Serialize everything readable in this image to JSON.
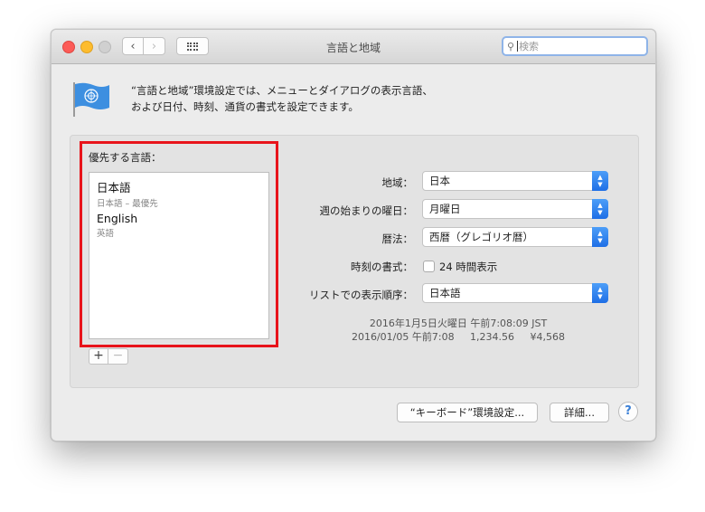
{
  "window": {
    "title": "言語と地域",
    "search_placeholder": "検索"
  },
  "description": {
    "line1": "“言語と地域”環境設定では、メニューとダイアログの表示言語、",
    "line2": "および日付、時刻、通貨の書式を設定できます。"
  },
  "languages": {
    "title": "優先する言語：",
    "items": [
      {
        "name": "日本語",
        "sub": "日本語 – 最優先"
      },
      {
        "name": "English",
        "sub": "英語"
      }
    ],
    "add_label": "+",
    "remove_label": "−"
  },
  "settings": {
    "region_label": "地域：",
    "region_value": "日本",
    "week_label": "週の始まりの曜日：",
    "week_value": "月曜日",
    "calendar_label": "暦法：",
    "calendar_value": "西暦（グレゴリオ暦）",
    "time_label": "時刻の書式：",
    "time_checkbox_label": "24 時間表示",
    "sort_label": "リストでの表示順序：",
    "sort_value": "日本語"
  },
  "sample": {
    "line1": "2016年1月5日火曜日 午前7:08:09 JST",
    "line2": "2016/01/05 午前7:08     1,234.56     ¥4,568"
  },
  "buttons": {
    "keyboard": "“キーボード”環境設定...",
    "advanced": "詳細...",
    "help": "?"
  },
  "colors": {
    "highlight_box": "#e8141b",
    "popup_accent": "#1f6fe6"
  }
}
